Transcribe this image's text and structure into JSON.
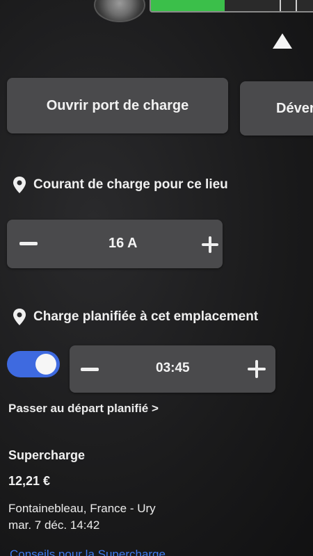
{
  "battery": {
    "level_fraction": 0.45,
    "fill_color": "#3bbf4a"
  },
  "icons": {
    "collapse": "chevron-up-icon",
    "pin": "location-pin-icon",
    "minus": "minus-icon",
    "plus": "plus-icon"
  },
  "buttons": {
    "open_port_label": "Ouvrir port de charge",
    "unlock_label": "Déver"
  },
  "charge_current": {
    "header": "Courant de charge pour ce lieu",
    "value": "16 A"
  },
  "scheduled_charge": {
    "header": "Charge planifiée à cet emplacement",
    "toggle_on": true,
    "toggle_color": "#3e6ae0",
    "time": "03:45",
    "departure_link": "Passer au départ planifié >"
  },
  "session": {
    "title": "Supercharge",
    "price": "12,21 €",
    "location": "Fontainebleau, France - Ury",
    "date": "mar. 7 déc. 14:42",
    "tips_link": "Conseils pour la Supercharge",
    "link_color": "#3f7bf0"
  }
}
